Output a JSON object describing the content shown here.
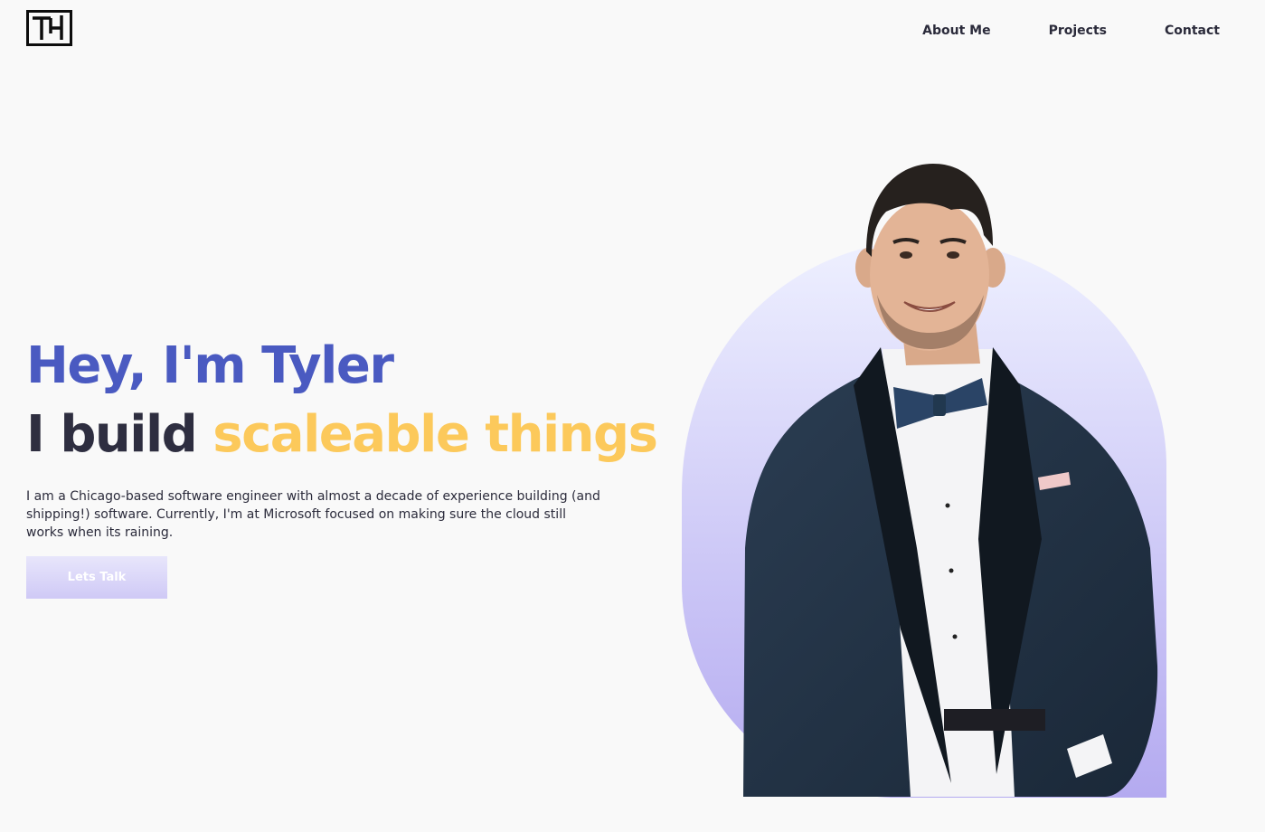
{
  "brand": {
    "logo_icon": "th-monogram-logo-icon"
  },
  "nav": {
    "items": [
      {
        "label": "About Me"
      },
      {
        "label": "Projects"
      },
      {
        "label": "Contact"
      }
    ]
  },
  "hero": {
    "greeting": "Hey, I'm Tyler",
    "tagline_lead": "I build",
    "tagline_accent": "scaleable things",
    "bio": "I am a Chicago-based software engineer with almost a decade of experience building (and shipping!) software. Currently, I'm at Microsoft focused on making sure the cloud still works when its raining.",
    "cta_label": "Lets Talk"
  },
  "colors": {
    "background": "#f9f9f9",
    "greeting": "#4a5ac1",
    "tagline": "#2e2e40",
    "accent": "#fcc95b",
    "cta_gradient_top": "#e8e6fb",
    "cta_gradient_bottom": "#cfc9f6",
    "arch_gradient_top": "#eef0ff",
    "arch_gradient_bottom": "#b4aaf0"
  }
}
